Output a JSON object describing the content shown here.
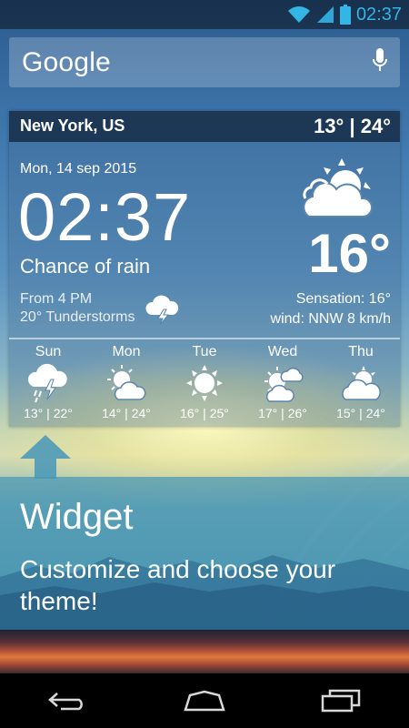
{
  "status_bar": {
    "time": "02:37",
    "icons": [
      "wifi-icon",
      "signal-icon",
      "battery-icon"
    ],
    "accent_color": "#33b5e5"
  },
  "search": {
    "logo_text": "Google",
    "mic_icon": "mic-icon"
  },
  "widget": {
    "location": "New York, US",
    "temp_range": "13° | 24°",
    "date": "Mon, 14 sep 2015",
    "time": "02:37",
    "condition": "Chance of rain",
    "alert_time": "From 4 PM",
    "alert_text": "20° Tunderstorms",
    "alert_icon": "thunderstorm-icon",
    "current_icon": "sun-cloud-icon",
    "current_temp": "16°",
    "sensation": "Sensation: 16°",
    "wind": "wind: NNW 8 km/h",
    "forecast": [
      {
        "day": "Sun",
        "range": "13° | 22°",
        "icon": "storm-rain-icon"
      },
      {
        "day": "Mon",
        "range": "14° | 24°",
        "icon": "sun-cloud-icon"
      },
      {
        "day": "Tue",
        "range": "16° | 25°",
        "icon": "sun-icon"
      },
      {
        "day": "Wed",
        "range": "17° | 26°",
        "icon": "sun-clouds-icon"
      },
      {
        "day": "Thu",
        "range": "15° | 24°",
        "icon": "sun-cloud-icon"
      }
    ]
  },
  "promo": {
    "title": "Widget",
    "subtitle": "Customize and choose your theme!"
  },
  "nav": {
    "buttons": [
      "back-icon",
      "home-icon",
      "recents-icon"
    ]
  }
}
